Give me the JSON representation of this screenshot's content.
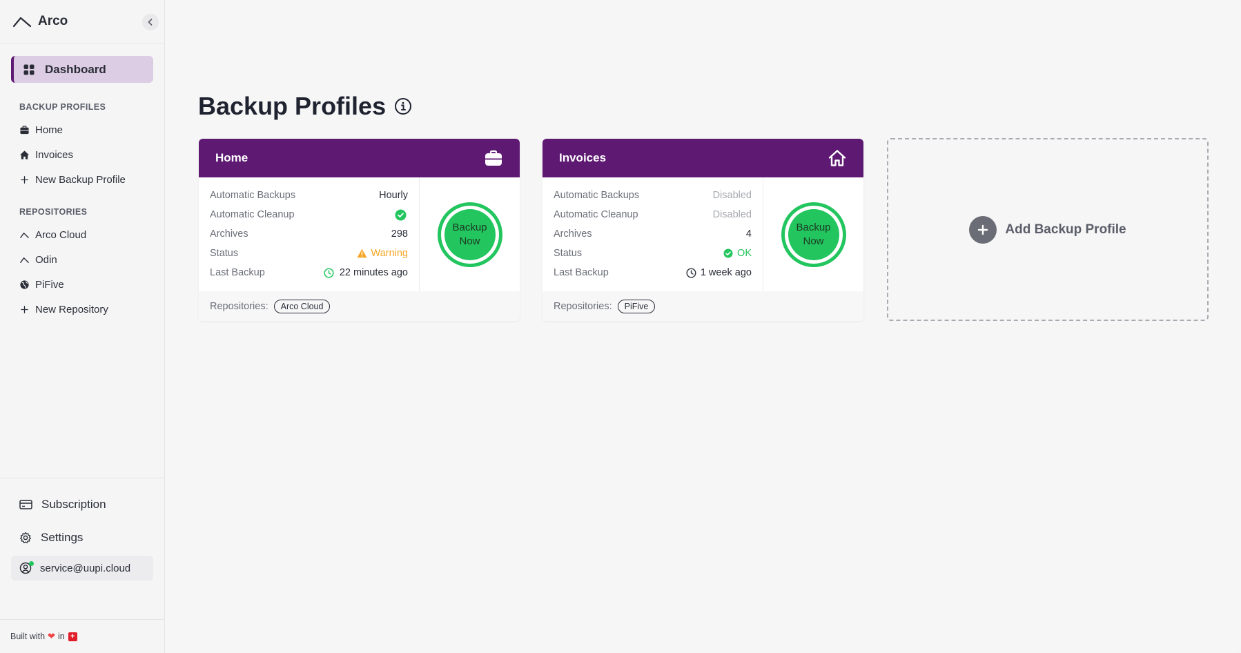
{
  "app": {
    "name": "Arco"
  },
  "sidebar": {
    "dashboard_label": "Dashboard",
    "backup_profiles_title": "BACKUP PROFILES",
    "backup_profiles": [
      {
        "label": "Home",
        "icon": "briefcase-icon"
      },
      {
        "label": "Invoices",
        "icon": "house-icon"
      },
      {
        "label": "New Backup Profile",
        "icon": "plus-icon"
      }
    ],
    "repositories_title": "REPOSITORIES",
    "repositories": [
      {
        "label": "Arco Cloud",
        "icon": "arco-logo-icon"
      },
      {
        "label": "Odin",
        "icon": "arco-logo-icon"
      },
      {
        "label": "PiFive",
        "icon": "globe-icon"
      },
      {
        "label": "New Repository",
        "icon": "plus-icon"
      }
    ],
    "subscription_label": "Subscription",
    "settings_label": "Settings",
    "user_email": "service@uupi.cloud",
    "footer": {
      "prefix": "Built with",
      "suffix": "in"
    }
  },
  "main": {
    "title": "Backup Profiles",
    "cards": [
      {
        "name": "Home",
        "header_icon": "briefcase-icon",
        "stats": [
          {
            "label": "Automatic Backups",
            "value": "Hourly"
          },
          {
            "label": "Automatic Cleanup",
            "value": ""
          },
          {
            "label": "Archives",
            "value": "298"
          },
          {
            "label": "Status",
            "value": "Warning"
          },
          {
            "label": "Last Backup",
            "value": "22 minutes ago"
          }
        ],
        "backup_button": "Backup Now",
        "repositories_label": "Repositories:",
        "repositories": [
          "Arco Cloud"
        ]
      },
      {
        "name": "Invoices",
        "header_icon": "house-icon",
        "stats": [
          {
            "label": "Automatic Backups",
            "value": "Disabled"
          },
          {
            "label": "Automatic Cleanup",
            "value": "Disabled"
          },
          {
            "label": "Archives",
            "value": "4"
          },
          {
            "label": "Status",
            "value": "OK"
          },
          {
            "label": "Last Backup",
            "value": "1 week ago"
          }
        ],
        "backup_button": "Backup Now",
        "repositories_label": "Repositories:",
        "repositories": [
          "PiFive"
        ]
      }
    ],
    "add_profile_label": "Add Backup Profile"
  },
  "colors": {
    "primary": "#5e1a73",
    "primary_light": "#dccde4",
    "success": "#22c55e",
    "warning": "#f5a623",
    "disabled": "#a7a9b0"
  }
}
